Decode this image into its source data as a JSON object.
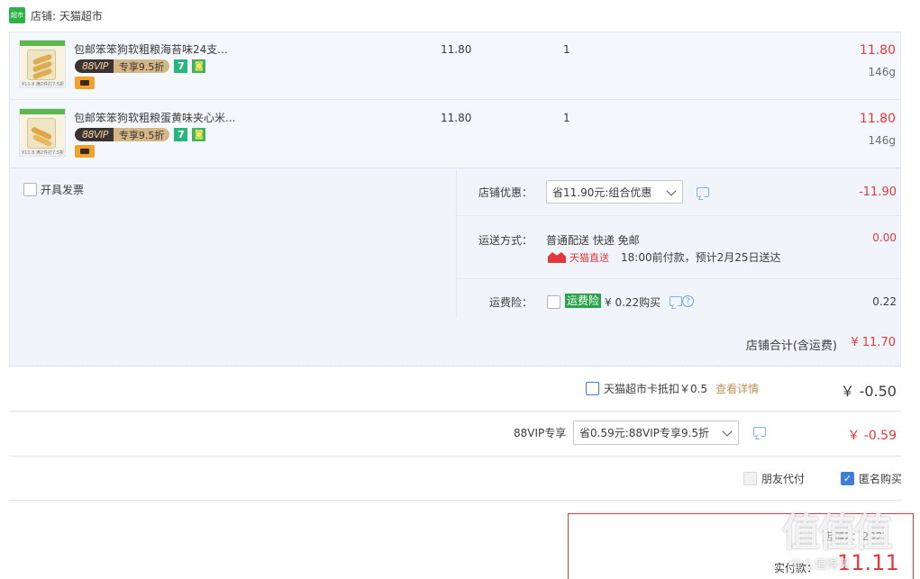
{
  "shop": {
    "logo_text": "超市",
    "label": "店铺: 天猫超市"
  },
  "items": [
    {
      "title": "包邮笨笨狗软粗粮海苔味24支...",
      "vip_left": "88VIP",
      "vip_right": "专享9.5折",
      "seven": "7",
      "price": "11.80",
      "qty": "1",
      "subtotal": "11.80",
      "weight": "146g",
      "thumb_price": "¥11.8",
      "thumb_note": "满2件打7.5折"
    },
    {
      "title": "包邮笨笨狗软粗粮蛋黄味夹心米...",
      "vip_left": "88VIP",
      "vip_right": "专享9.5折",
      "seven": "7",
      "price": "11.80",
      "qty": "1",
      "subtotal": "11.80",
      "weight": "146g",
      "thumb_price": "¥11.8",
      "thumb_note": "满2件打7.5折"
    }
  ],
  "invoice": {
    "label": "开具发票"
  },
  "shop_discount": {
    "label": "店铺优惠：",
    "selected": "省11.90元:组合优惠",
    "amount": "-11.90"
  },
  "shipping": {
    "label": "运送方式：",
    "method": "普通配送 快递 免邮",
    "direct_label": "天猫直送",
    "delivery_note": "18:00前付款，预计2月25日送达",
    "amount": "0.00"
  },
  "insurance": {
    "label": "运费险：",
    "tag": "运费险",
    "price": "¥ 0.22购买",
    "amount": "0.22"
  },
  "store_total": {
    "label": "店铺合计(含运费)",
    "amount": "¥ 11.70"
  },
  "card_deduct": {
    "label": "天猫超市卡抵扣￥0.5",
    "link": "查看详情",
    "amount": "￥ -0.50"
  },
  "vip_discount": {
    "label": "88VIP专享",
    "selected": "省0.59元:88VIP专享9.5折",
    "amount": "￥ -0.59"
  },
  "options": {
    "friend_pay": "朋友代付",
    "anonymous": "匿名购买"
  },
  "final": {
    "partial_top": "店铺2：292",
    "partial_label": "实付款：",
    "amount": "11.11"
  },
  "watermark": {
    "text": "值值值",
    "site": "什么值得买"
  },
  "colors": {
    "price_red": "#e4393c",
    "panel_bg": "#f1f5fb",
    "link_orange": "#c38f57",
    "check_blue": "#3f7ed8"
  }
}
